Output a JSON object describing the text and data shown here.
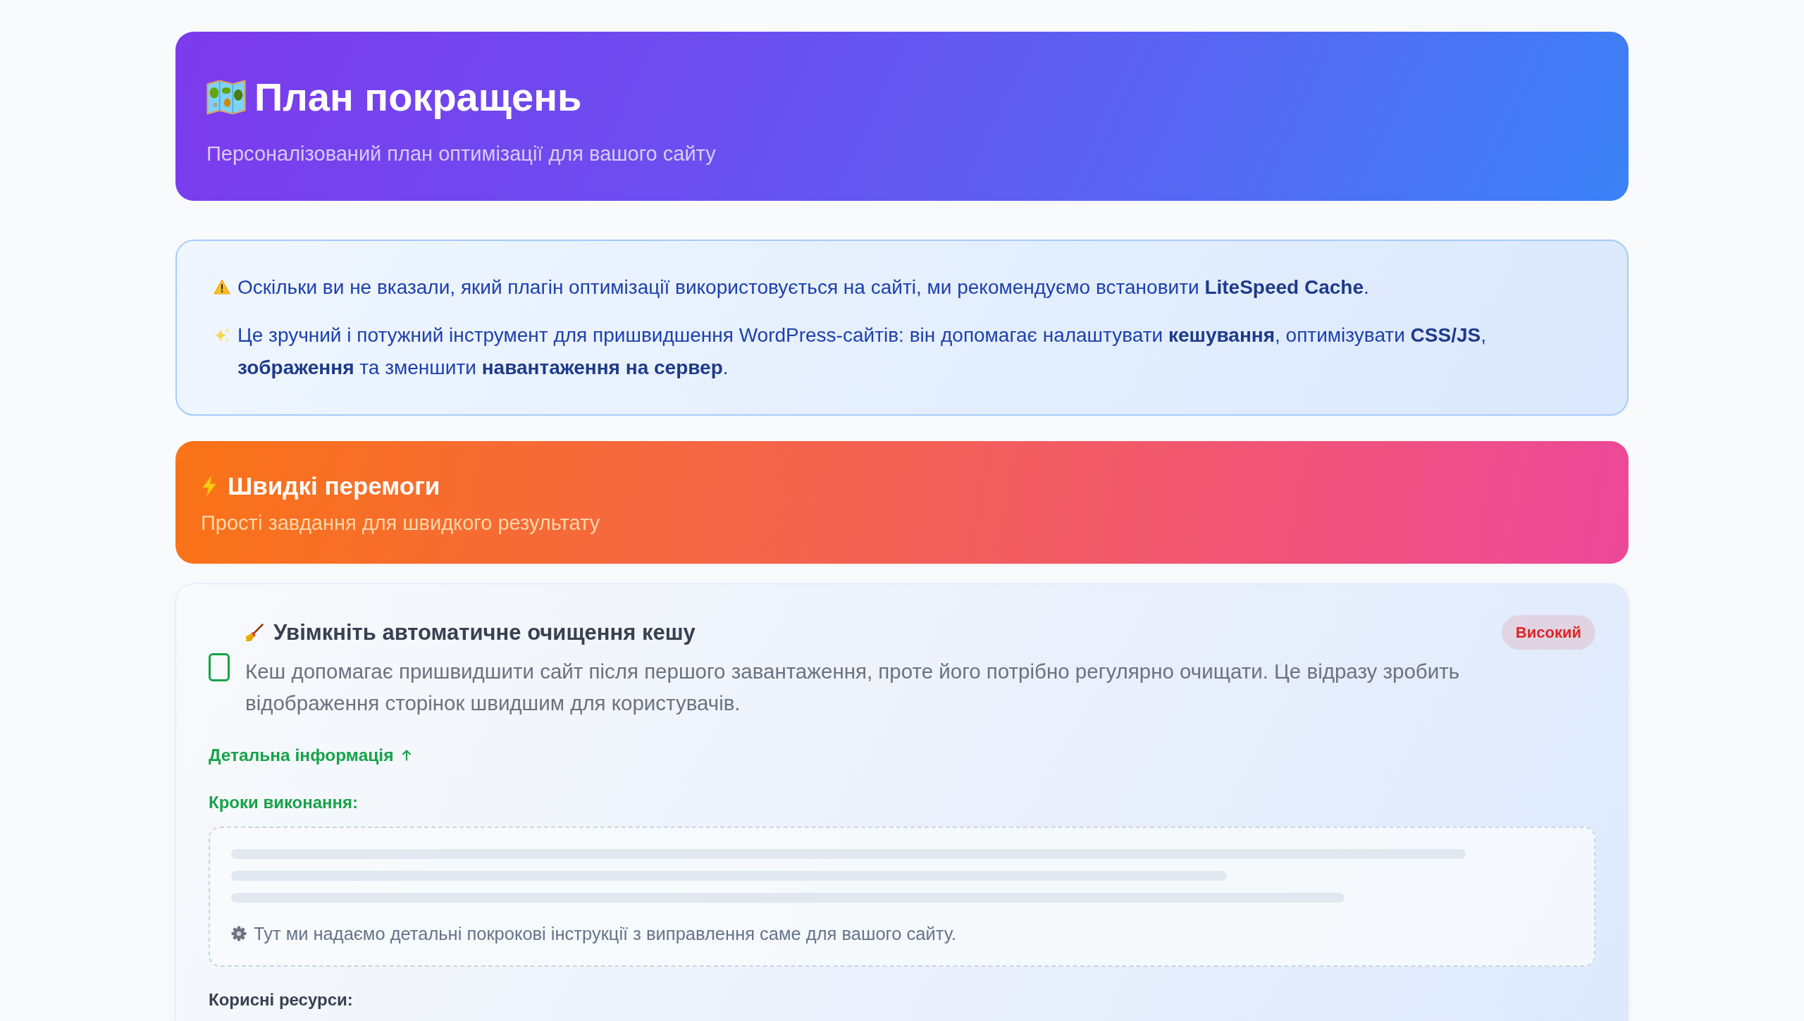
{
  "header": {
    "title": "План покращень",
    "subtitle": "Персоналізований план оптимізації для вашого сайту"
  },
  "notice": {
    "paragraphs": [
      {
        "kind": "warning",
        "text": "Оскільки ви не вказали, який плагін оптимізації використовується на сайті, ми рекомендуємо встановити **LiteSpeed Cache**."
      },
      {
        "kind": "sparkle",
        "text": "Це зручний і потужний інструмент для пришвидшення WordPress-сайтів: він допомагає налаштувати **кешування**, оптимізувати **CSS/JS**, **зображення** та зменшити **навантаження на сервер**."
      }
    ]
  },
  "section": {
    "title": "Швидкі перемоги",
    "subtitle": "Прості завдання для швидкого результату"
  },
  "tasks": [
    {
      "title": "Увімкніть автоматичне очищення кешу",
      "description": "Кеш допомагає пришвидшити сайт після першого завантаження, проте його потрібно регулярно очищати. Це відразу зробить відображення сторінок швидшим для користувачів.",
      "checked": false,
      "priority": {
        "label": "Високий",
        "kind": "high"
      },
      "details": {
        "label": "Детальна інформація",
        "expanded": true,
        "steps_heading": "Кроки виконання:",
        "steps_note": "Тут ми надаємо детальні покрокові інструкції з виправлення саме для вашого сайту.",
        "resources_heading": "Корисні ресурси:"
      }
    }
  ]
}
